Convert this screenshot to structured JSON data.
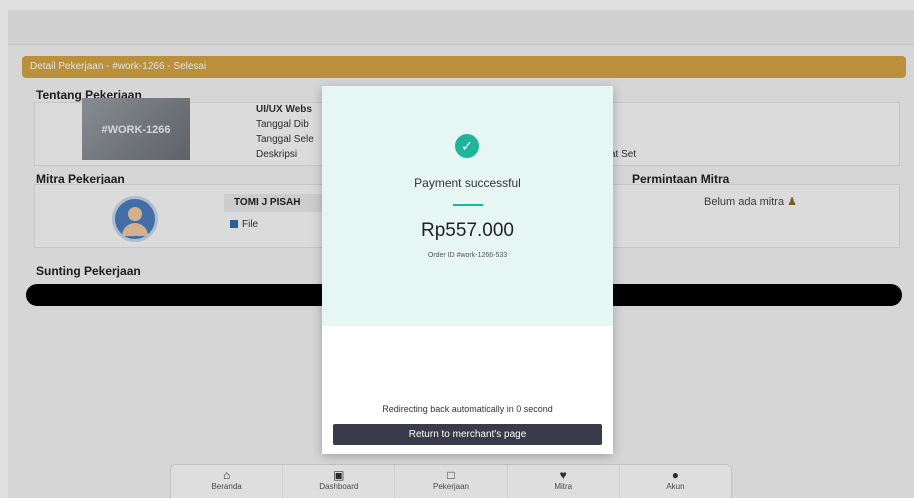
{
  "status_bar": {
    "text": "Detail Pekerjaan - #work-1266 - Selesai"
  },
  "about": {
    "title": "Tentang Pekerjaan",
    "thumb_text": "#WORK-1266",
    "job_title": "UI/UX Webs",
    "date_created_label": "Tanggal Dib",
    "date_done_label": "Tanggal Sele",
    "desc_label": "Deskripsi",
    "desc_tail": "at Set"
  },
  "partner": {
    "title": "Mitra Pekerjaan",
    "name": "TOMI J PISAH",
    "file_label": "File"
  },
  "requests": {
    "title": "Permintaan Mitra",
    "empty_text": "Belum ada mitra"
  },
  "edit": {
    "title": "Sunting Pekerjaan"
  },
  "nav": {
    "items": [
      {
        "label": "Beranda",
        "icon": "home-icon"
      },
      {
        "label": "Dashboard",
        "icon": "dashboard-icon"
      },
      {
        "label": "Pekerjaan",
        "icon": "briefcase-icon"
      },
      {
        "label": "Mitra",
        "icon": "handshake-icon"
      },
      {
        "label": "Akun",
        "icon": "user-icon"
      }
    ]
  },
  "modal": {
    "title": "Payment successful",
    "amount": "Rp557.000",
    "order_id": "Order ID #work-1266-533",
    "redirect_text": "Redirecting back automatically in 0 second",
    "return_button": "Return to merchant's page"
  },
  "colors": {
    "accent": "#1fb59a",
    "status_bar": "#d4a543"
  }
}
